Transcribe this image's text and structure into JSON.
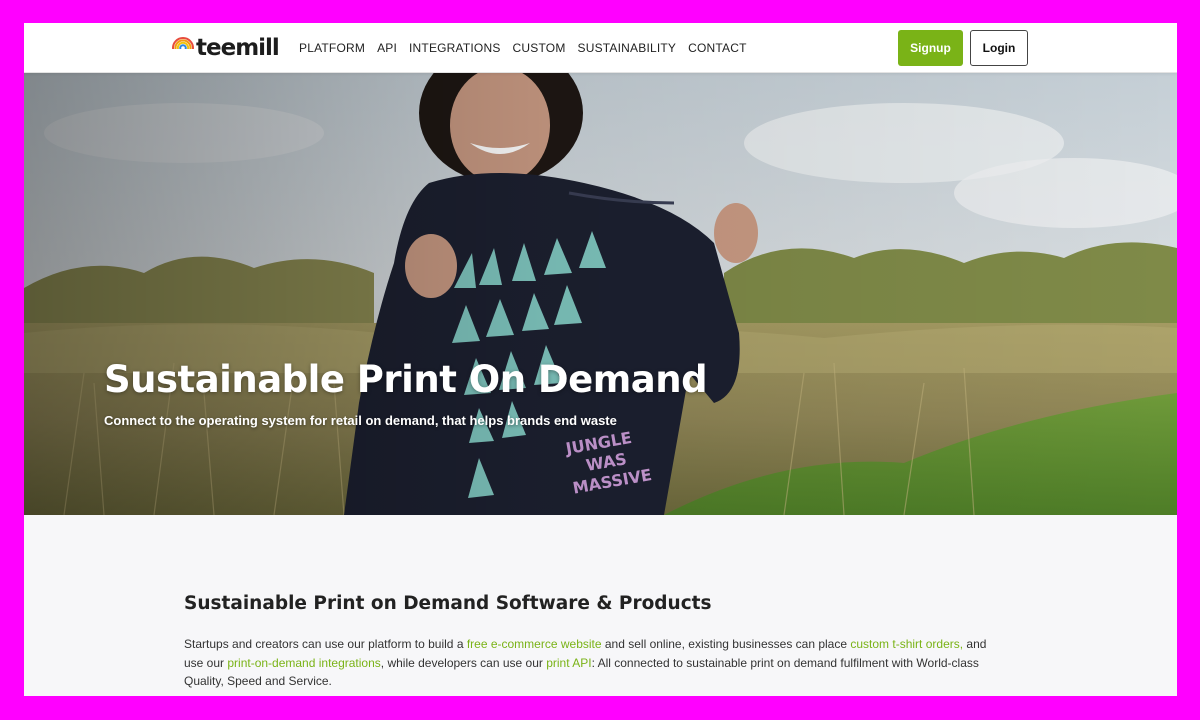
{
  "header": {
    "logo_text": "teemill",
    "nav": [
      "PLATFORM",
      "API",
      "INTEGRATIONS",
      "CUSTOM",
      "SUSTAINABILITY",
      "CONTACT"
    ],
    "signup_label": "Signup",
    "login_label": "Login"
  },
  "hero": {
    "title": "Sustainable Print On Demand",
    "subtitle": "Connect to the operating system for retail on demand, that helps brands end waste",
    "shirt_print_text": "JUNGLE WAS MASSIVE"
  },
  "content": {
    "heading": "Sustainable Print on Demand Software & Products",
    "paragraph": [
      {
        "text": "Startups and creators can use our platform to build a ",
        "link": false
      },
      {
        "text": "free e-commerce website",
        "link": true
      },
      {
        "text": " and sell online, existing businesses can place ",
        "link": false
      },
      {
        "text": "custom t-shirt orders,",
        "link": true
      },
      {
        "text": " and use our ",
        "link": false
      },
      {
        "text": "print-on-demand integrations",
        "link": true
      },
      {
        "text": ", while developers can use our ",
        "link": false
      },
      {
        "text": "print API",
        "link": true
      },
      {
        "text": ": All connected to sustainable print on demand fulfilment with World-class Quality, Speed and Service.",
        "link": false
      }
    ]
  },
  "colors": {
    "accent": "#7ab317",
    "page_border": "#ff00ff",
    "hoodie": "#1c2030",
    "print_teal": "#7fc6bf",
    "print_pink": "#c99ad6"
  }
}
